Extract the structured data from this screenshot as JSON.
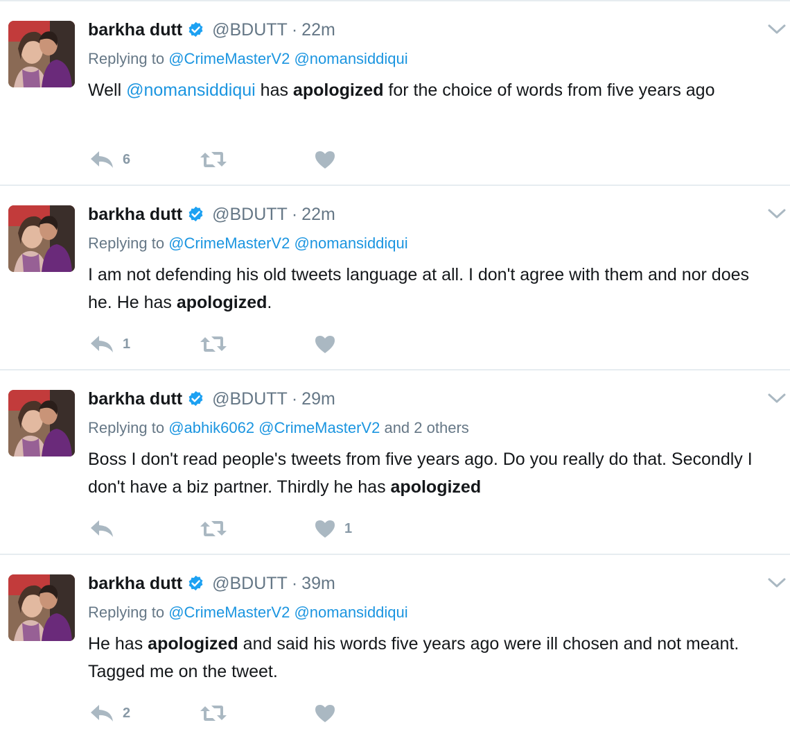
{
  "tweets": [
    {
      "name": "barkha dutt",
      "handle": "@BDUTT",
      "separator": "·",
      "time": "22m",
      "replying_prefix": "Replying to",
      "replying_to": "@CrimeMasterV2 @nomansiddiqui",
      "replying_suffix": "",
      "text_parts": [
        {
          "t": "Well ",
          "s": "normal"
        },
        {
          "t": "@nomansiddiqui",
          "s": "mention"
        },
        {
          "t": "  has ",
          "s": "normal"
        },
        {
          "t": "apologized",
          "s": "bold"
        },
        {
          "t": " for the choice of words from five years ago",
          "s": "normal"
        }
      ],
      "reply_count": "6",
      "retweet_count": "",
      "like_count": ""
    },
    {
      "name": "barkha dutt",
      "handle": "@BDUTT",
      "separator": "·",
      "time": "22m",
      "replying_prefix": "Replying to",
      "replying_to": "@CrimeMasterV2 @nomansiddiqui",
      "replying_suffix": "",
      "text_parts": [
        {
          "t": "I am not defending his old tweets language at all. I don't agree with them and nor does he. He has ",
          "s": "normal"
        },
        {
          "t": "apologized",
          "s": "bold"
        },
        {
          "t": ".",
          "s": "normal"
        }
      ],
      "reply_count": "1",
      "retweet_count": "",
      "like_count": ""
    },
    {
      "name": "barkha dutt",
      "handle": "@BDUTT",
      "separator": "·",
      "time": "29m",
      "replying_prefix": "Replying to",
      "replying_to": "@abhik6062 @CrimeMasterV2",
      "replying_suffix": "and 2 others",
      "text_parts": [
        {
          "t": "Boss I don't read people's tweets from five years ago. Do you really do that. Secondly I don't have a biz partner. Thirdly he has ",
          "s": "normal"
        },
        {
          "t": "apologized",
          "s": "bold"
        }
      ],
      "reply_count": "",
      "retweet_count": "",
      "like_count": "1"
    },
    {
      "name": "barkha dutt",
      "handle": "@BDUTT",
      "separator": "·",
      "time": "39m",
      "replying_prefix": "Replying to",
      "replying_to": "@CrimeMasterV2 @nomansiddiqui",
      "replying_suffix": "",
      "text_parts": [
        {
          "t": "He has ",
          "s": "normal"
        },
        {
          "t": "apologized",
          "s": "bold"
        },
        {
          "t": " and said his words five years ago were ill chosen and not meant. Tagged me on the tweet.",
          "s": "normal"
        }
      ],
      "reply_count": "2",
      "retweet_count": "",
      "like_count": ""
    }
  ],
  "colors": {
    "text": "#14171a",
    "secondary": "#657786",
    "link": "#1b95e0",
    "icon": "#aab8c2",
    "verified": "#1da1f2",
    "divider": "#e6ecf0"
  },
  "icons": {
    "reply": "reply-icon",
    "retweet": "retweet-icon",
    "like": "heart-icon",
    "verified": "verified-badge-icon",
    "menu": "chevron-down-icon"
  }
}
